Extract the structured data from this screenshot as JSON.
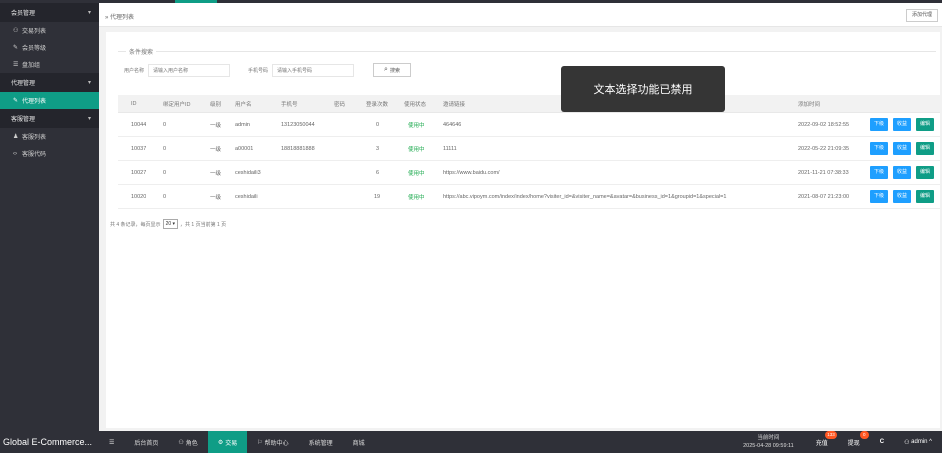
{
  "sidebar": {
    "groups": [
      {
        "label": "会员管理",
        "items": [
          {
            "icon": "person-icon",
            "glyph": "⚇",
            "label": "交易列表"
          },
          {
            "icon": "link-icon",
            "glyph": "✎",
            "label": "会员等级"
          },
          {
            "icon": "list-icon",
            "glyph": "☰",
            "label": "盘加组"
          }
        ]
      },
      {
        "label": "代理管理",
        "items": [
          {
            "icon": "link-icon",
            "glyph": "✎",
            "label": "代理列表",
            "active": true
          }
        ]
      },
      {
        "label": "客服管理",
        "items": [
          {
            "icon": "users-icon",
            "glyph": "♟",
            "label": "客服列表"
          },
          {
            "icon": "code-icon",
            "glyph": "‹›",
            "label": "客服代码"
          }
        ]
      }
    ]
  },
  "header": {
    "breadcrumb": "» 代理列表",
    "add_button": "添加代理"
  },
  "search": {
    "legend": "条件搜索",
    "username_label": "用户名称",
    "username_placeholder": "请输入用户名称",
    "phone_label": "手机号码",
    "phone_placeholder": "请输入手机号码",
    "search_button": "搜索"
  },
  "table": {
    "columns": [
      "ID",
      "绑定用户ID",
      "级别",
      "用户名",
      "手机号",
      "密码",
      "登录次数",
      "使用状态",
      "邀请链接",
      "添加时间"
    ],
    "rows": [
      {
        "id": "10044",
        "uid": "0",
        "level": "一级",
        "user": "admin",
        "phone": "13123050044",
        "pwd": "",
        "logins": "0",
        "status": "使用中",
        "link": "464646",
        "time": "2022-09-02 18:52:55"
      },
      {
        "id": "10037",
        "uid": "0",
        "level": "一级",
        "user": "a00001",
        "phone": "18818881888",
        "pwd": "",
        "logins": "3",
        "status": "使用中",
        "link": "11111",
        "time": "2022-05-22 21:09:35"
      },
      {
        "id": "10027",
        "uid": "0",
        "level": "一级",
        "user": "ceshidaili3",
        "phone": "",
        "pwd": "",
        "logins": "6",
        "status": "使用中",
        "link": "https://www.baidu.com/",
        "time": "2021-11-21 07:38:33"
      },
      {
        "id": "10020",
        "uid": "0",
        "level": "一级",
        "user": "ceshidaili",
        "phone": "",
        "pwd": "",
        "logins": "19",
        "status": "使用中",
        "link": "https://abc.vipoym.com/index/index/home?visiter_id=&visiter_name=&avatar=&business_id=1&groupid=1&special=1",
        "time": "2021-08-07 21:23:00"
      }
    ],
    "actions": [
      "下级",
      "收益",
      "编辑"
    ]
  },
  "pager": {
    "prefix": "共 4 条记录，每页显示",
    "per_page": "20",
    "suffix": "，共 1 页当前第 1 页"
  },
  "toast": "文本选择功能已禁用",
  "taskbar": {
    "brand": "Global E-Commerce...",
    "menu_icon": "☰",
    "items": [
      {
        "icon": "",
        "label": "后台首页"
      },
      {
        "icon": "⚇",
        "label": "角色"
      },
      {
        "icon": "⚙",
        "label": "交易",
        "active": true
      },
      {
        "icon": "⚐",
        "label": "帮助中心"
      },
      {
        "icon": "",
        "label": "系统管理"
      },
      {
        "icon": "",
        "label": "商城"
      }
    ],
    "clock_label": "当前时间",
    "clock_value": "2025-04-28 09:59:11",
    "recharge": "充值",
    "recharge_badge": "133",
    "withdraw": "提现",
    "withdraw_badge": "0",
    "refresh": "C",
    "user": "admin"
  }
}
